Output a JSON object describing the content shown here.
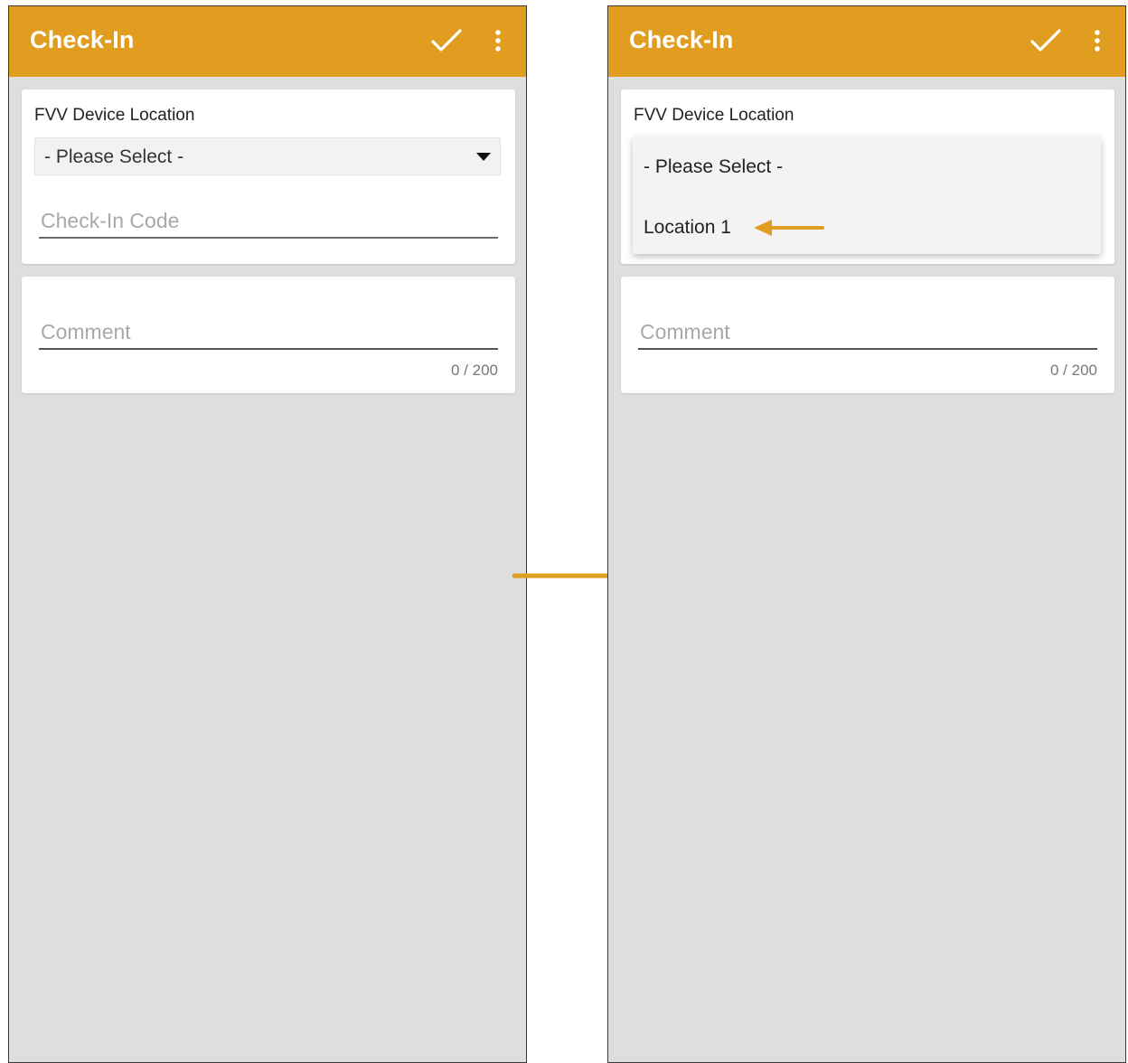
{
  "colors": {
    "accent": "#e09d1f",
    "background": "#dedede",
    "card": "#ffffff"
  },
  "left_screen": {
    "title": "Check-In",
    "actions": {
      "confirm_icon": "check-icon",
      "menu_icon": "more-vert-icon"
    },
    "location_field": {
      "label": "FVV Device Location",
      "selected_value": "- Please Select -"
    },
    "checkin_code": {
      "placeholder": "Check-In Code",
      "value": ""
    },
    "comment": {
      "placeholder": "Comment",
      "value": "",
      "counter": "0 / 200"
    }
  },
  "right_screen": {
    "title": "Check-In",
    "actions": {
      "confirm_icon": "check-icon",
      "menu_icon": "more-vert-icon"
    },
    "location_field": {
      "label": "FVV Device Location",
      "options": [
        "- Please Select -",
        "Location 1"
      ]
    },
    "comment": {
      "placeholder": "Comment",
      "value": "",
      "counter": "0 / 200"
    }
  },
  "annotations": {
    "flow_arrow_icon": "arrow-right-icon",
    "pointer_arrow_icon": "arrow-left-icon"
  }
}
